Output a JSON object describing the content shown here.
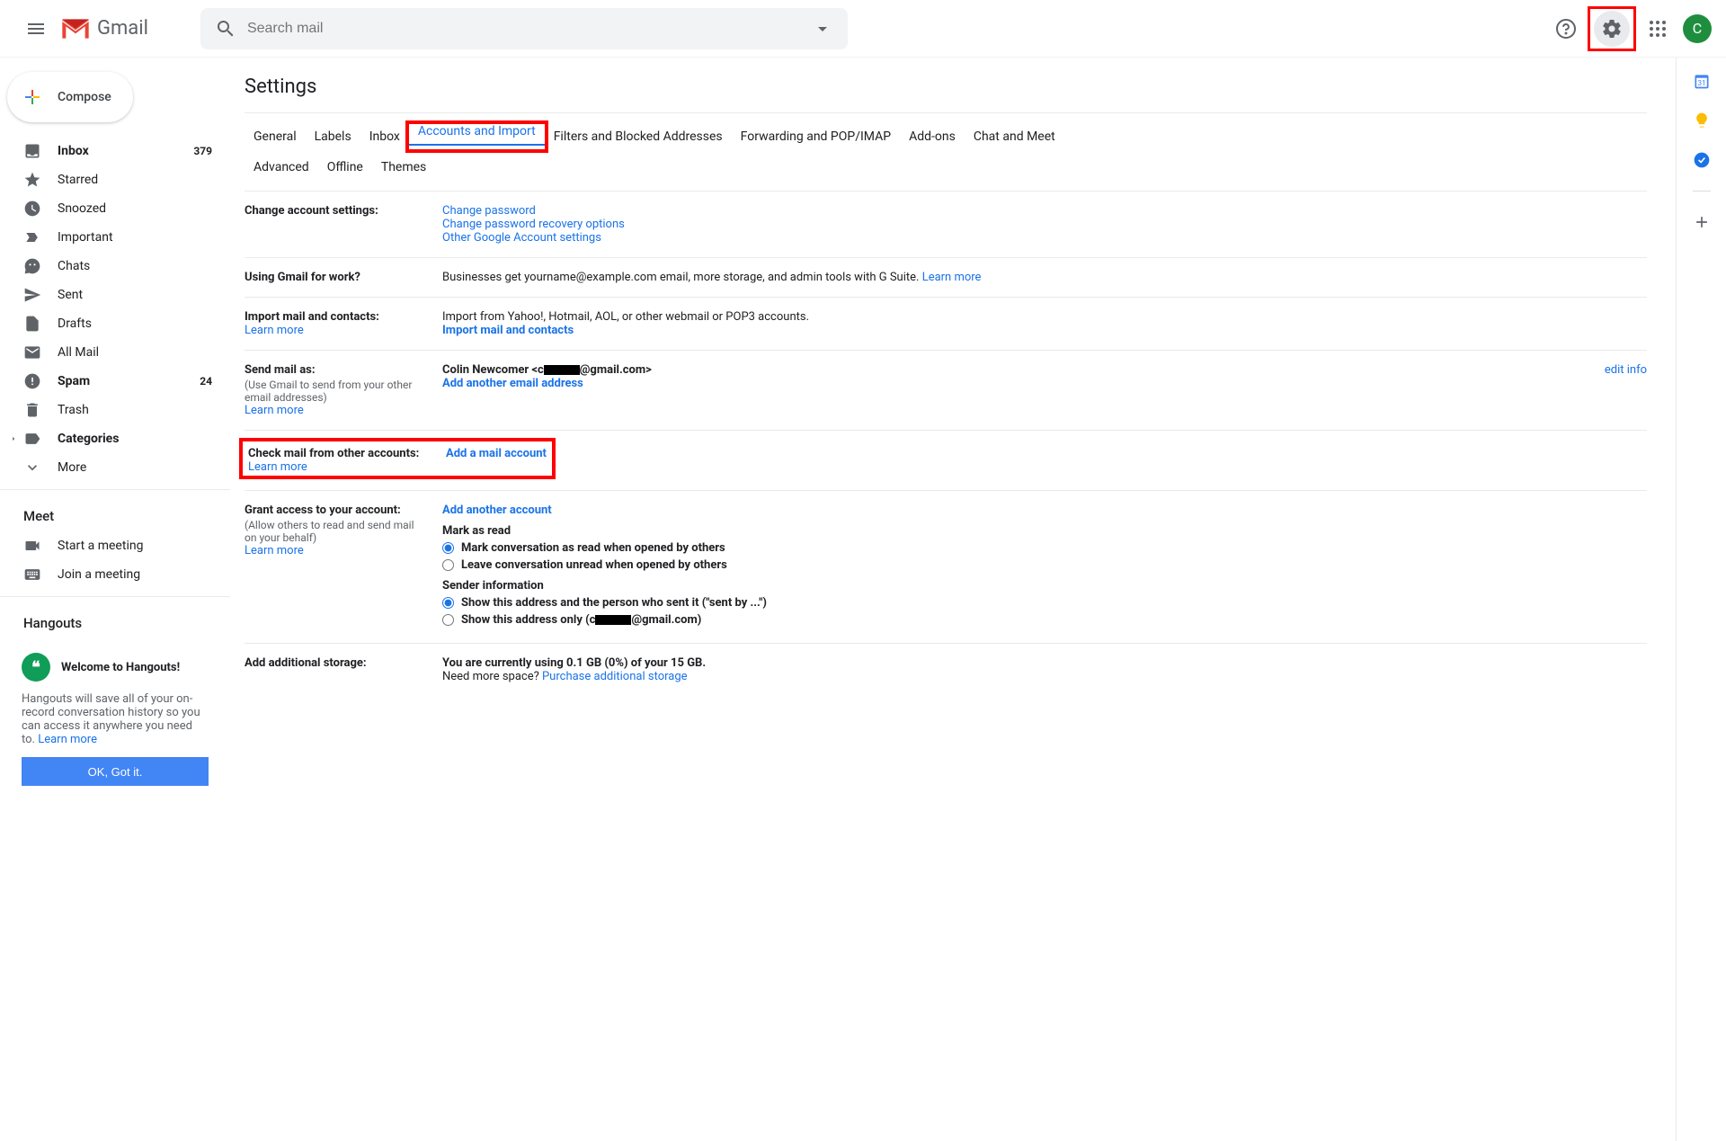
{
  "header": {
    "brand": "Gmail",
    "search_placeholder": "Search mail",
    "avatar_letter": "C"
  },
  "compose_label": "Compose",
  "sidebar": [
    {
      "label": "Inbox",
      "count": "379",
      "bold": true,
      "icon": "inbox"
    },
    {
      "label": "Starred",
      "icon": "star"
    },
    {
      "label": "Snoozed",
      "icon": "clock"
    },
    {
      "label": "Important",
      "icon": "important"
    },
    {
      "label": "Chats",
      "icon": "chat"
    },
    {
      "label": "Sent",
      "icon": "send"
    },
    {
      "label": "Drafts",
      "icon": "file"
    },
    {
      "label": "All Mail",
      "icon": "mail"
    },
    {
      "label": "Spam",
      "count": "24",
      "bold": true,
      "icon": "spam"
    },
    {
      "label": "Trash",
      "icon": "trash"
    },
    {
      "label": "Categories",
      "bold": true,
      "icon": "tag",
      "caret": true
    },
    {
      "label": "More",
      "icon": "expand"
    }
  ],
  "meet": {
    "title": "Meet",
    "start": "Start a meeting",
    "join": "Join a meeting"
  },
  "hangouts": {
    "title": "Hangouts",
    "welcome": "Welcome to Hangouts!",
    "body": "Hangouts will save all of your on-record conversation history so you can access it anywhere you need to. ",
    "learn": "Learn more",
    "ok": "OK, Got it."
  },
  "settings": {
    "title": "Settings",
    "tabs": [
      "General",
      "Labels",
      "Inbox",
      "Accounts and Import",
      "Filters and Blocked Addresses",
      "Forwarding and POP/IMAP",
      "Add-ons",
      "Chat and Meet",
      "Advanced",
      "Offline",
      "Themes"
    ],
    "active_tab": "Accounts and Import",
    "change_account": {
      "label": "Change account settings:",
      "links": [
        "Change password",
        "Change password recovery options",
        "Other Google Account settings"
      ]
    },
    "work": {
      "label": "Using Gmail for work?",
      "text": "Businesses get yourname@example.com email, more storage, and admin tools with G Suite. ",
      "learn": "Learn more"
    },
    "import": {
      "label": "Import mail and contacts:",
      "learn": "Learn more",
      "text": "Import from Yahoo!, Hotmail, AOL, or other webmail or POP3 accounts.",
      "action": "Import mail and contacts"
    },
    "send_as": {
      "label": "Send mail as:",
      "sub": "(Use Gmail to send from your other email addresses)",
      "learn": "Learn more",
      "name_pre": "Colin Newcomer <c",
      "name_post": "@gmail.com>",
      "add": "Add another email address",
      "edit": "edit info"
    },
    "check_mail": {
      "label": "Check mail from other accounts:",
      "learn": "Learn more",
      "add": "Add a mail account"
    },
    "grant": {
      "label": "Grant access to your account:",
      "sub": "(Allow others to read and send mail on your behalf)",
      "learn": "Learn more",
      "add": "Add another account",
      "mark_head": "Mark as read",
      "mark1": "Mark conversation as read when opened by others",
      "mark2": "Leave conversation unread when opened by others",
      "sender_head": "Sender information",
      "sender1": "Show this address and the person who sent it (\"sent by ...\")",
      "sender2_pre": "Show this address only (c",
      "sender2_post": "@gmail.com)"
    },
    "storage": {
      "label": "Add additional storage:",
      "text": "You are currently using 0.1 GB (0%) of your 15 GB.",
      "need": "Need more space? ",
      "purchase": "Purchase additional storage"
    }
  }
}
